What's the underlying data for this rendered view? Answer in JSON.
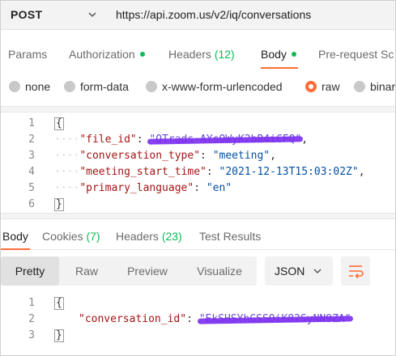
{
  "request": {
    "method": "POST",
    "url": "https://api.zoom.us/v2/iq/conversations"
  },
  "request_tabs": {
    "params": "Params",
    "authorization": "Authorization",
    "headers": "Headers",
    "headers_count": "(12)",
    "body": "Body",
    "pre_request": "Pre-request Sc"
  },
  "body_types": {
    "none": "none",
    "form_data": "form-data",
    "urlencoded": "x-www-form-urlencoded",
    "raw": "raw",
    "binary": "binar"
  },
  "request_body": {
    "line_numbers": [
      "1",
      "2",
      "3",
      "4",
      "5",
      "6"
    ],
    "open": "{",
    "close": "}",
    "file_id_key": "\"file_id\"",
    "file_id_value": "\"QTrads-AYsOWyK2bB4iCFQ\"",
    "conversation_type_key": "\"conversation_type\"",
    "conversation_type_value": "\"meeting\"",
    "meeting_start_time_key": "\"meeting_start_time\"",
    "meeting_start_time_value": "\"2021-12-13T15:03:02Z\"",
    "primary_language_key": "\"primary_language\"",
    "primary_language_value": "\"en\""
  },
  "response_tabs": {
    "body": "Body",
    "cookies": "Cookies",
    "cookies_count": "(7)",
    "headers": "Headers",
    "headers_count": "(23)",
    "test_results": "Test Results"
  },
  "response_toolbar": {
    "pretty": "Pretty",
    "raw": "Raw",
    "preview": "Preview",
    "visualize": "Visualize",
    "format": "JSON"
  },
  "response_body": {
    "line_numbers": [
      "1",
      "2",
      "3"
    ],
    "open": "{",
    "close": "}",
    "conversation_id_key": "\"conversation_id\"",
    "conversation_id_value": "\"EkSHSYhGSSOiK82SyNN9ZA\""
  },
  "colors": {
    "accent": "#ff6c37",
    "success": "#0cbb52",
    "json_key": "#a31515",
    "json_string": "#0451a5"
  },
  "icons": [
    "chevron-down-icon",
    "wrap-lines-icon"
  ]
}
